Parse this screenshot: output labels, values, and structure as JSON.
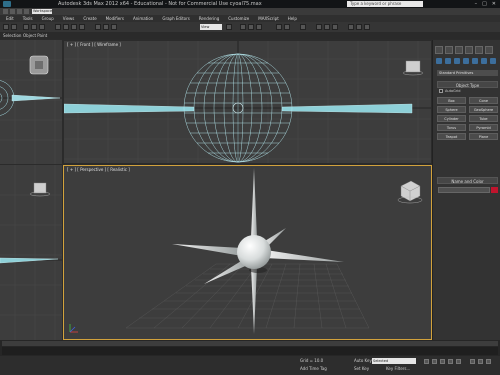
{
  "window": {
    "title": "Autodesk 3ds Max 2012 x64 - Educational - Not for Commercial Use   cyoal75.max",
    "search_placeholder": "Type a keyword or phrase",
    "minimize": "–",
    "maximize": "□",
    "close": "✕"
  },
  "toolbar": {
    "workspace": "Workspace: Default"
  },
  "menubar": {
    "items": [
      "Edit",
      "Tools",
      "Group",
      "Views",
      "Create",
      "Modifiers",
      "Animation",
      "Graph Editors",
      "Rendering",
      "Customize",
      "MAXScript",
      "Help"
    ]
  },
  "maintool": {
    "ref_coord": "View"
  },
  "ribbon": {
    "tab1": "Selection",
    "tab2": "Object Paint"
  },
  "viewports": {
    "top_label": "",
    "front_label": "[ + ] [ Front ] [ Wireframe ]",
    "left_label": "",
    "persp_label": "[ + ] [ Perspective ] [ Realistic ]"
  },
  "command_panel": {
    "dropdown": "Standard Primitives",
    "object_type_title": "Object Type",
    "autogrid": "AutoGrid",
    "objects": [
      "Box",
      "Cone",
      "Sphere",
      "GeoSphere",
      "Cylinder",
      "Tube",
      "Torus",
      "Pyramid",
      "Teapot",
      "Plane"
    ],
    "name_color_title": "Name and Color",
    "accent_color": "#c0142d"
  },
  "timeline": {
    "frame_counter": "0 / 100"
  },
  "statusbar": {
    "add_time_tag": "Add Time Tag",
    "grid": "Grid = 10.0",
    "auto_key": "Auto Key",
    "set_key": "Set Key",
    "selected": "Selected",
    "key_filters": "Key Filters..."
  }
}
